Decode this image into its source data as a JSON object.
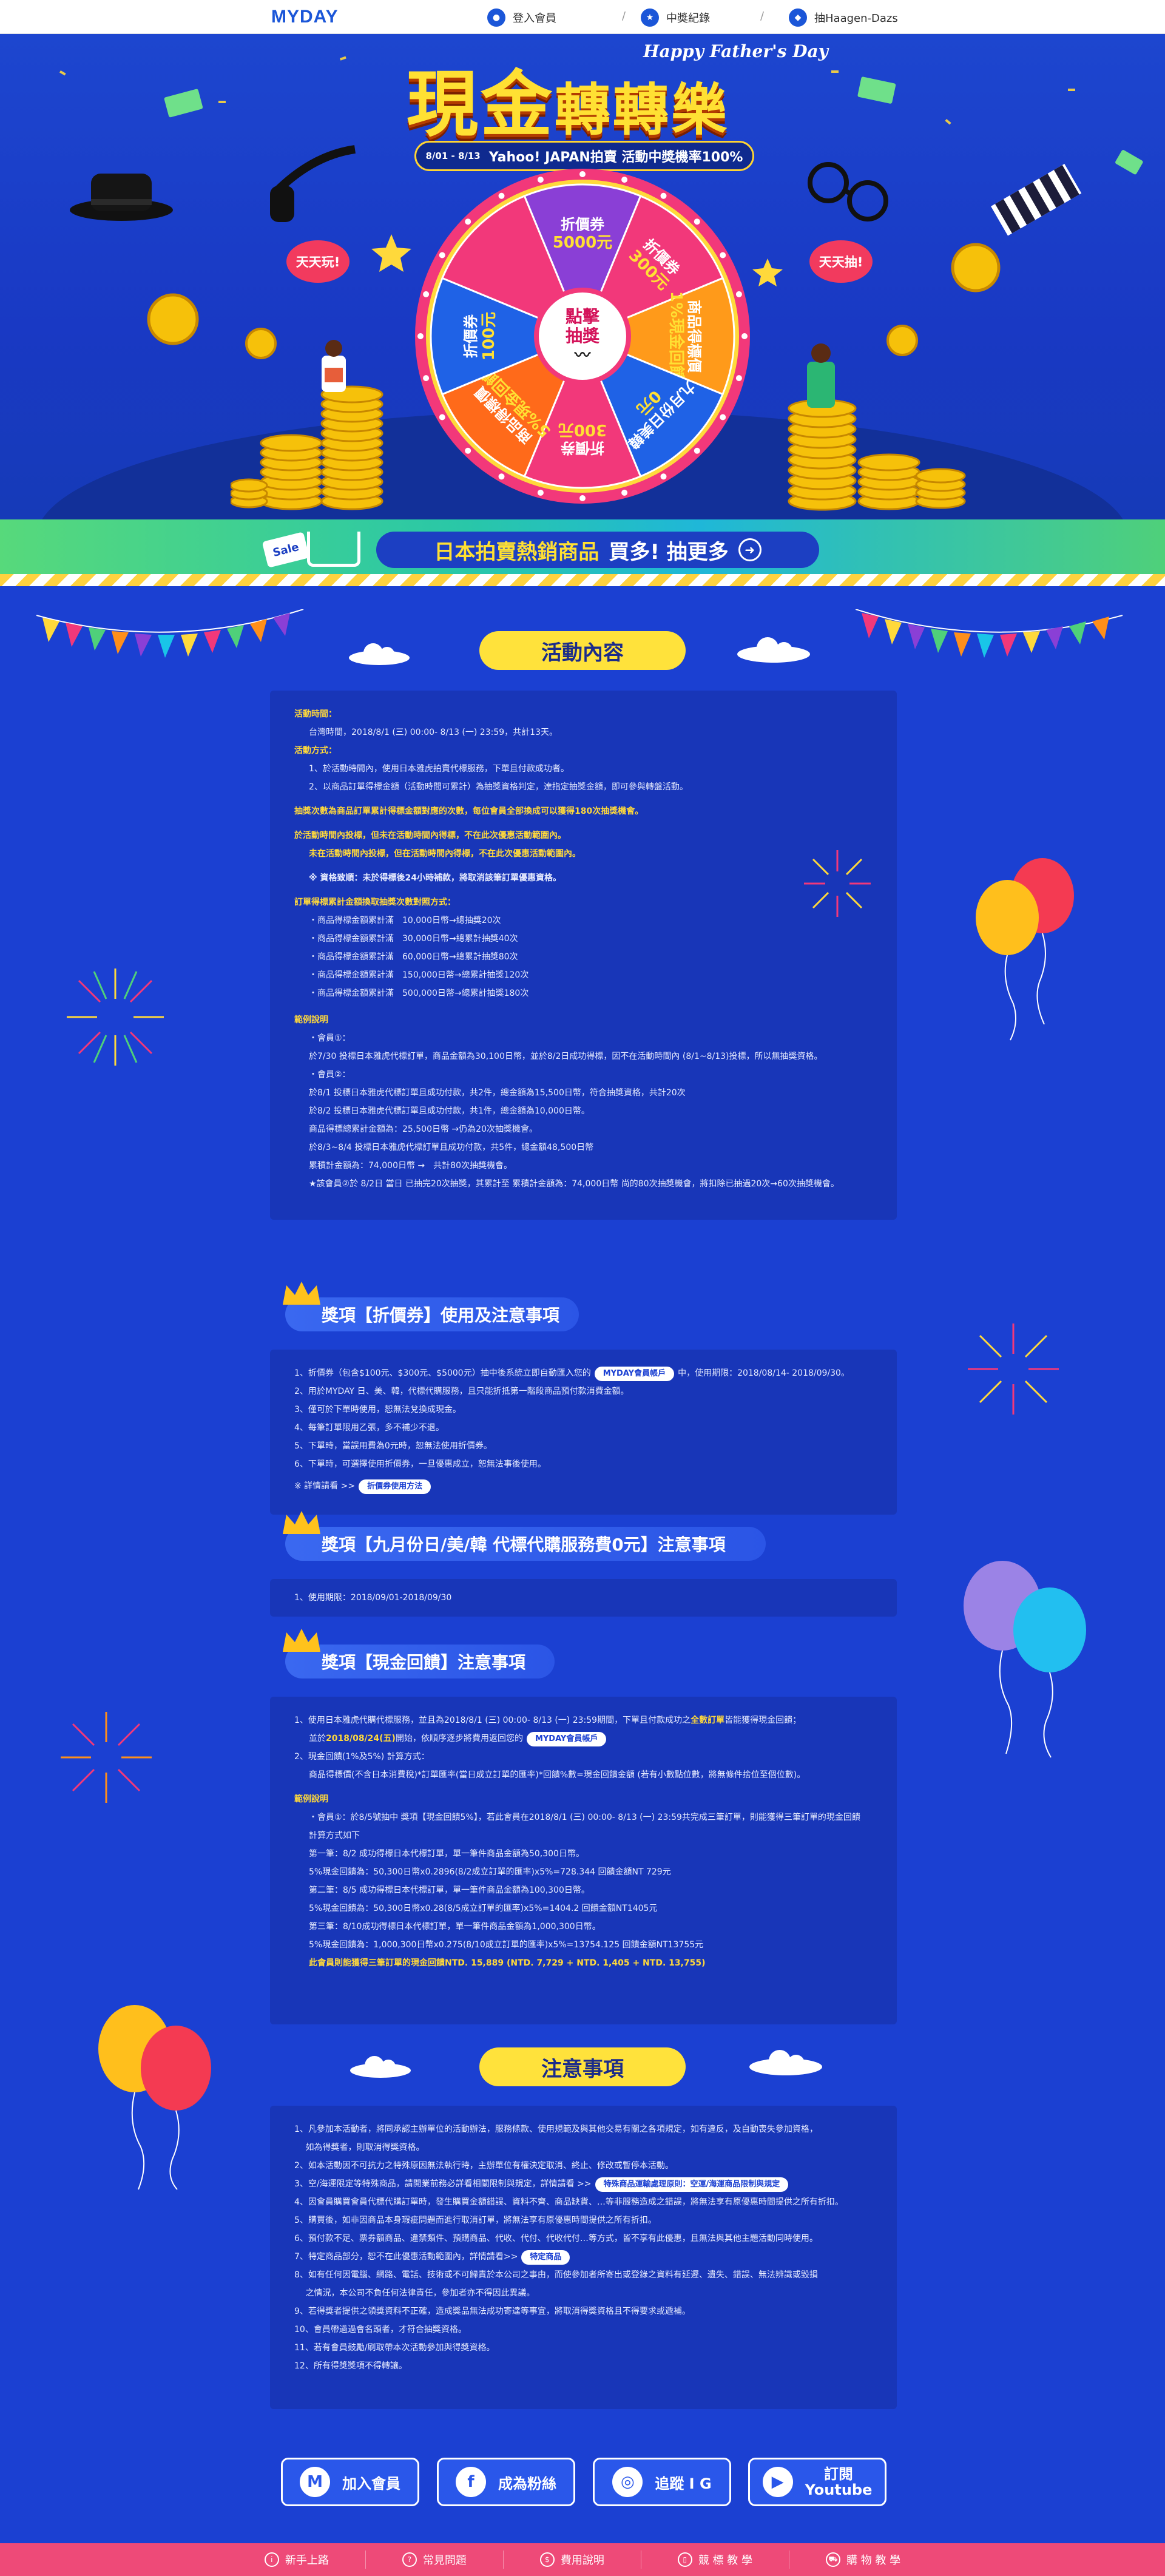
{
  "nav": {
    "logo": "MYDAY",
    "links": [
      {
        "label": "登入會員",
        "icon": "user-icon"
      },
      {
        "label": "中獎紀錄",
        "icon": "trophy-icon"
      },
      {
        "label": "抽Haagen-Dazs",
        "icon": "ice-cream-icon"
      }
    ],
    "separator": "/"
  },
  "hero": {
    "title_a": "現金",
    "title_b": "轉轉樂",
    "subtitle": "Happy Father's Day",
    "period": "8/01 - 8/13",
    "tagline": "Yahoo! JAPAN拍賣  活動中獎機率100%",
    "bubble_left": "天天玩!",
    "bubble_right": "天天抽!",
    "wheel_center_top": "點擊",
    "wheel_center_bottom": "抽獎",
    "wheel_segments": [
      {
        "line1": "折價券",
        "line2": "5000元",
        "color": "#8a3fd6"
      },
      {
        "line1": "折價券",
        "line2": "300元",
        "color": "#f2387a"
      },
      {
        "line1": "商品得標價",
        "line2": "1%現金回饋",
        "color": "#ff9a1a"
      },
      {
        "line1": "九月份日美韓",
        "line2": "0元",
        "color": "#1f62e6"
      },
      {
        "line1": "折價券",
        "line2": "300元",
        "color": "#f2387a"
      },
      {
        "line1": "商品得標價",
        "line2": "5%現金回饋",
        "color": "#ff6a1a"
      },
      {
        "line1": "折價券",
        "line2": "100元",
        "color": "#1f62e6"
      },
      {
        "line1": "",
        "line2": "",
        "color": "#f2387a"
      }
    ]
  },
  "sale_banner": {
    "tag": "Sale",
    "text_a": "日本拍賣熱銷商品",
    "text_b": "買多! 抽更多"
  },
  "activity": {
    "title": "活動內容",
    "time_head": "活動時間：",
    "time_text": "台灣時間，2018/8/1 (三) 00:00- 8/13 (一) 23:59，共計13天。",
    "method_head": "活動方式：",
    "method_1": "1、於活動時間內，使用日本雅虎拍賣代標服務，下單且付款成功者。",
    "method_2": "2、以商品訂單得標金額（活動時間可累計）為抽獎資格判定，達指定抽獎金額，即可參與轉盤活動。",
    "note_1": "抽獎次數為商品訂單累計得標金額對應的次數，每位會員全部換成可以獲得180次抽獎機會。",
    "note_2a": "於活動時間內投標，但未在活動時間內得標，不在此次優惠活動範圍內。",
    "note_2b": "未在活動時間內投標，但在活動時間內得標，不在此次優惠活動範圍內。",
    "note_3": "※ 資格致順：未於得標後24小時補款，將取消該筆訂單優惠資格。",
    "tier_head": "訂單得標累計金額換取抽獎次數對照方式：",
    "tiers": [
      "・商品得標金額累計滿　10,000日幣→總抽獎20次",
      "・商品得標金額累計滿　30,000日幣→總累計抽獎40次",
      "・商品得標金額累計滿　60,000日幣→總累計抽獎80次",
      "・商品得標金額累計滿　150,000日幣→總累計抽獎120次",
      "・商品得標金額累計滿　500,000日幣→總累計抽獎180次"
    ],
    "ex_head": "範例說明",
    "ex_lines": [
      "・會員①：",
      "於7/30 投標日本雅虎代標訂單，商品金額為30,100日幣，並於8/2日成功得標，因不在活動時間內 (8/1~8/13)投標，所以無抽獎資格。",
      "・會員②：",
      "於8/1 投標日本雅虎代標訂單且成功付款，共2件，總金額為15,500日幣，符合抽獎資格，共計20次",
      "於8/2 投標日本雅虎代標訂單且成功付款，共1件，總金額為10,000日幣。",
      "商品得標總累計金額為：25,500日幣 →仍為20次抽獎機會。",
      "於8/3~8/4 投標日本雅虎代標訂單且成功付款，共5件，總金額48,500日幣",
      "累積計金額為：74,000日幣 →　共計80次抽獎機會。",
      "★該會員②於 8/2日 當日 已抽完20次抽獎，其累計至 累積計金額為：74,000日幣 尚的80次抽獎機會，將扣除已抽過20次→60次抽獎機會。"
    ]
  },
  "coupon": {
    "title": "獎項【折價券】使用及注意事項",
    "lines": [
      "1、折價券（包含$100元、$300元、$5000元）抽中後系統立即自動匯入您的",
      "2、用於MYDAY 日、美、韓，代標代購服務，且只能折抵第一階段商品預付款消費金額。",
      "3、僅可於下單時使用，恕無法兌換成現金。",
      "4、每筆訂單限用乙張，多不補少不退。",
      "5、下單時，當誤用費為0元時，恕無法使用折價券。",
      "6、下單時，可選擇使用折價券，一旦優惠成立，恕無法事後使用。"
    ],
    "chip_account": "MYDAY會員帳戶",
    "line1_tail": "中，使用期限：2018/08/14- 2018/09/30。",
    "detail_prefix": "※ 詳情請看 >>",
    "chip_detail": "折價券使用方法"
  },
  "september": {
    "title": "獎項【九月份日/美/韓 代標代購服務費0元】注意事項",
    "lines": [
      "1、使用期限：2018/09/01-2018/09/30"
    ]
  },
  "cashback": {
    "title": "獎項【現金回饋】注意事項",
    "l1": "1、使用日本雅虎代購代標服務，並且為2018/8/1 (三) 00:00- 8/13 (一) 23:59期間，下單且付款成功之",
    "l1_bold": "全數訂單",
    "l1_tail": "皆能獲得現金回饋；",
    "l1b_pre": "並於",
    "l1b_bold": "2018/08/24(五)",
    "l1b_tail": "開始，依順序逐步將費用返回您的",
    "chip": "MYDAY會員帳戶",
    "l2": "2、現金回饋(1%及5%) 計算方式：",
    "l2b": "商品得標價(不含日本消費稅)*訂單匯率(當日成立訂單的匯率)*回饋%數=現金回饋金額 (若有小數點位數，將無條件捨位至個位數)。",
    "ex_head": "範例說明",
    "ex": [
      "・會員①：於8/5號抽中 獎項【現金回饋5%】，若此會員在2018/8/1 (三) 00:00- 8/13 (一) 23:59共完成三筆訂單，則能獲得三筆訂單的現金回饋",
      "計算方式如下",
      "第一筆：8/2 成功得標日本代標訂單，單一筆件商品金額為50,300日幣。",
      "5%現金回饋為：50,300日幣x0.2896(8/2成立訂單的匯率)x5%=728.344 回饋金額NT 729元",
      "第二筆：8/5 成功得標日本代標訂單，單一筆件商品金額為100,300日幣。",
      "5%現金回饋為：50,300日幣x0.28(8/5成立訂單的匯率)x5%=1404.2 回饋金額NT1405元",
      "第三筆：8/10成功得標日本代標訂單，單一筆件商品金額為1,000,300日幣。",
      "5%現金回饋為：1,000,300日幣x0.275(8/10成立訂單的匯率)x5%=13754.125 回饋金額NT13755元"
    ],
    "ex_total": "此會員則能獲得三筆訂單的現金回饋NTD. 15,889 (NTD. 7,729 + NTD. 1,405 + NTD. 13,755)"
  },
  "notes": {
    "title": "注意事項",
    "lines": [
      "1、凡參加本活動者，將同承認主辦單位的活動辦法，服務條款、使用規範及與其他交易有關之各項規定，如有違反，及自動喪失參加資格，",
      "　  如為得獎者，則取消得獎資格。",
      "2、如本活動因不可抗力之特殊原因無法執行時，主辦單位有權決定取消、終止、修改或暫停本活動。",
      "3、空/海運限定等特殊商品，請開業前務必詳看相關限制與規定，詳情請看 >>",
      "4、因會員購買會員代標代購訂單時，發生購買金額錯誤、資料不齊、商品缺貨、…等非服務造成之錯誤，將無法享有原優惠時間提供之所有折扣。",
      "5、購買後，如非因商品本身瑕疵問題而進行取消訂單，將無法享有原優惠時間提供之所有折扣。",
      "6、預付款不足、票券額商品、違禁類件、預購商品、代收、代付、代收代付…等方式，皆不享有此優惠，且無法與其他主題活動同時使用。",
      "7、特定商品部分，恕不在此優惠活動範圍內，詳情請看>>",
      "8、如有任何因電腦、網路、電話、技術或不可歸責於本公司之事由，而使參加者所寄出或登錄之資料有延遲、遺失、錯誤、無法辨識或毀損",
      "　  之情況，本公司不負任何法律責任，參加者亦不得因此異議。",
      "9、若得獎者提供之領獎資料不正確，造成獎品無法成功寄達等事宜，將取消得獎資格且不得要求或遞補。",
      "10、會員帶過過會名頭者，才符合抽獎資格。",
      "11、若有會員鼓勵/刷取帶本次活動參加與得獎資格。",
      "12、所有得獎獎項不得轉讓。"
    ],
    "chip_3": "特殊商品運輸處理原則：空運/海運商品限制與規定",
    "chip_7": "特定商品"
  },
  "social": [
    {
      "label": "加入會員",
      "icon": "m-icon",
      "glyph": "M"
    },
    {
      "label": "成為粉絲",
      "icon": "facebook-icon",
      "glyph": "f"
    },
    {
      "label": "追蹤 I G",
      "icon": "instagram-icon",
      "glyph": "◎"
    },
    {
      "label": "訂閱\nYoutube",
      "icon": "youtube-icon",
      "glyph": "▶"
    }
  ],
  "bottom": [
    {
      "label": "新手上路",
      "icon": "info-icon",
      "glyph": "i"
    },
    {
      "label": "常見問題",
      "icon": "question-icon",
      "glyph": "?"
    },
    {
      "label": "費用說明",
      "icon": "fee-icon",
      "glyph": "$"
    },
    {
      "label": "競 標 教 學",
      "icon": "phone-icon",
      "glyph": "▯"
    },
    {
      "label": "購 物 教 學",
      "icon": "cart-icon",
      "glyph": "⛟"
    }
  ],
  "colors": {
    "brand": "#1b56d8",
    "bg": "#1b40d2",
    "accent": "#ffe23b",
    "pink": "#ee4a78"
  }
}
